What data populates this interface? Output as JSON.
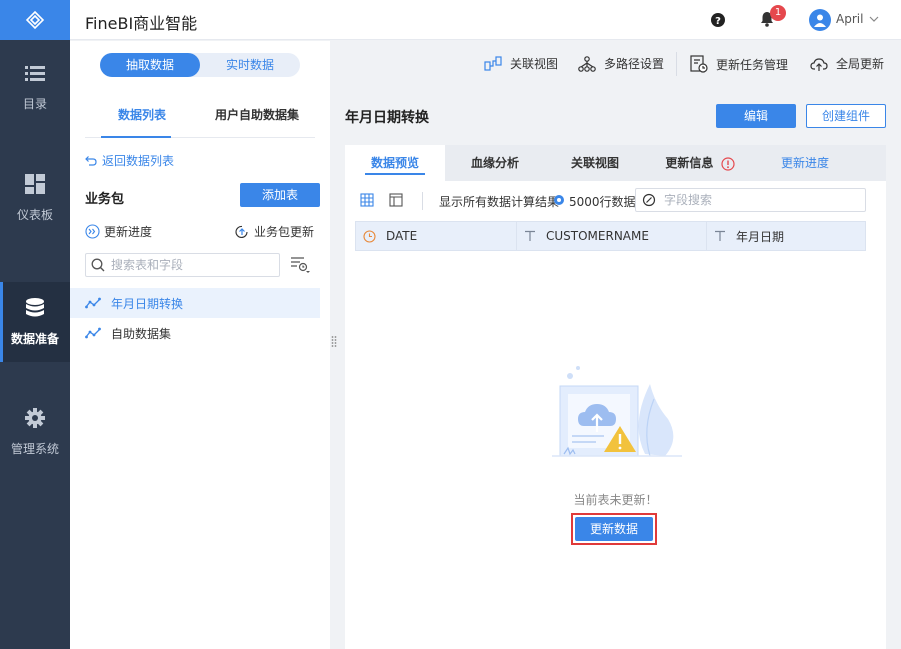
{
  "app": {
    "title": "FineBI商业智能"
  },
  "topbar": {
    "notification_count": "1",
    "user": "April"
  },
  "nav": {
    "items": [
      {
        "label": "目录",
        "icon": "list-icon"
      },
      {
        "label": "仪表板",
        "icon": "dashboard-icon"
      },
      {
        "label": "数据准备",
        "icon": "database-icon",
        "active": true
      },
      {
        "label": "管理系统",
        "icon": "gear-icon"
      }
    ]
  },
  "left": {
    "mode_tabs": [
      "抽取数据",
      "实时数据"
    ],
    "list_tabs": [
      "数据列表",
      "用户自助数据集"
    ],
    "back_link": "返回数据列表",
    "package_label": "业务包",
    "add_table": "添加表",
    "update_progress": "更新进度",
    "package_update": "业务包更新",
    "search_placeholder": "搜索表和字段",
    "datasets": [
      "年月日期转换",
      "自助数据集"
    ]
  },
  "toolbar": {
    "items": [
      "关联视图",
      "多路径设置",
      "更新任务管理",
      "全局更新"
    ]
  },
  "detail": {
    "title": "年月日期转换",
    "edit": "编辑",
    "create_component": "创建组件",
    "tabs": [
      "数据预览",
      "血缘分析",
      "关联视图",
      "更新信息",
      "更新进度"
    ],
    "show_all_text": "显示所有数据计算结果",
    "row_text": "5000行数据",
    "field_search_placeholder": "字段搜索",
    "columns": [
      "DATE",
      "CUSTOMERNAME",
      "年月日期"
    ],
    "empty_text": "当前表未更新！",
    "refresh_button": "更新数据"
  },
  "colors": {
    "accent": "#3a86e8",
    "nav_bg": "#2d3a4e",
    "highlight_frame": "#e03a3a"
  }
}
